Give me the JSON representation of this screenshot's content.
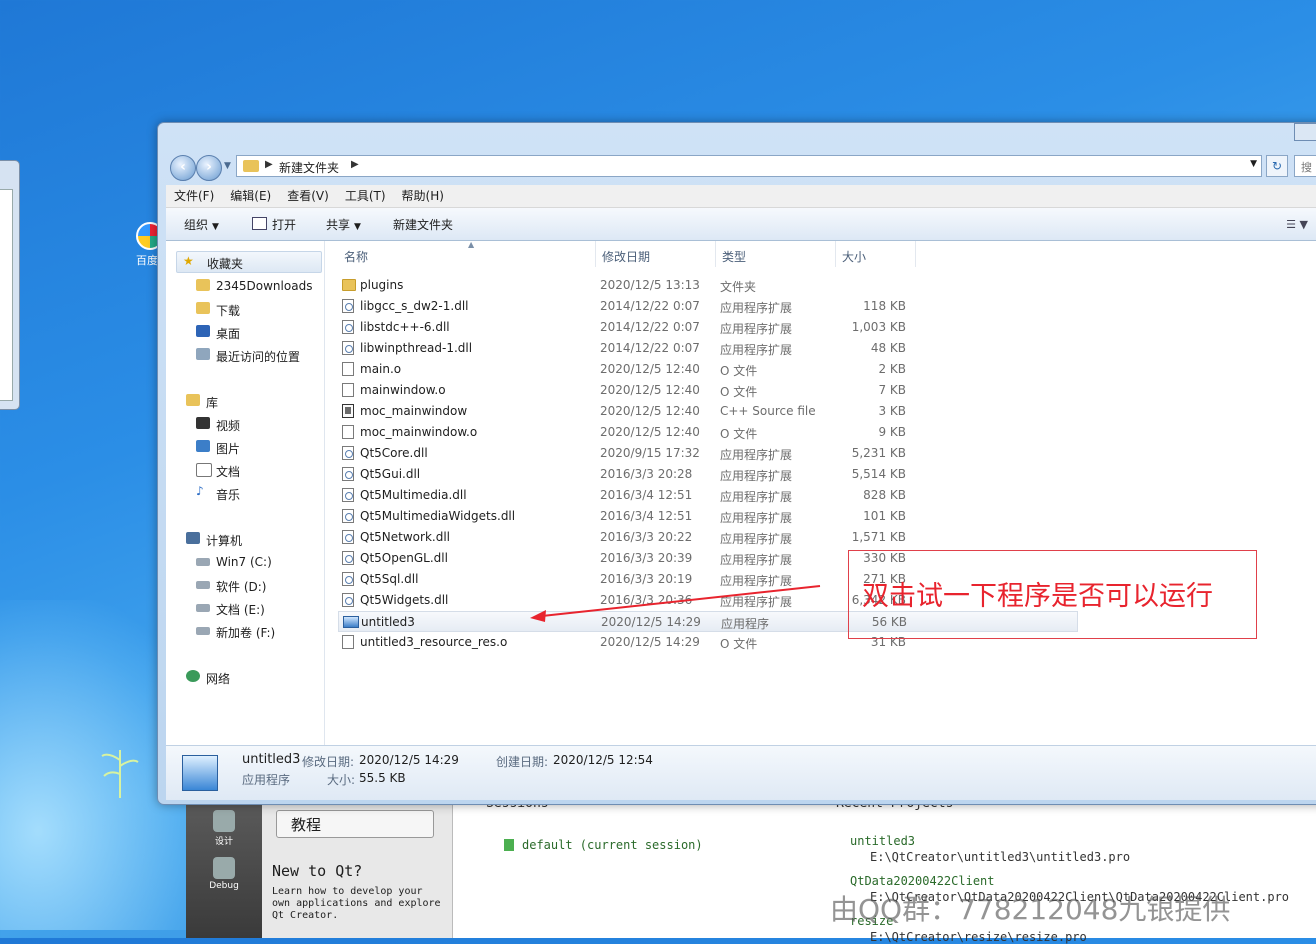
{
  "desktop": {
    "icon_label": "百度",
    "qt": {
      "modes": [
        {
          "label": "设计"
        },
        {
          "label": "Debug"
        }
      ],
      "tutorial_button": "教程",
      "new_heading": "New to Qt?",
      "new_desc": "Learn how to develop your own applications and explore Qt Creator.",
      "sessions_title": "Sessions",
      "session_item": "default (current session)",
      "recent_title": "Recent Projects",
      "recent": [
        {
          "name": "untitled3",
          "path": "E:\\QtCreator\\untitled3\\untitled3.pro"
        },
        {
          "name": "QtData20200422Client",
          "path": "E:\\QtCreator\\QtData20200422Client\\QtData20200422Client.pro"
        },
        {
          "name": "resize",
          "path": "E:\\QtCreator\\resize\\resize.pro"
        }
      ]
    },
    "watermark": "由QQ群：778212048九银提供"
  },
  "explorer": {
    "address": {
      "crumb": "新建文件夹",
      "search_placeholder": "搜"
    },
    "menu": [
      "文件(F)",
      "编辑(E)",
      "查看(V)",
      "工具(T)",
      "帮助(H)"
    ],
    "toolbar": {
      "organize": "组织",
      "open": "打开",
      "share": "共享",
      "new_folder": "新建文件夹"
    },
    "nav": {
      "favorites": "收藏夹",
      "fav_items": [
        "2345Downloads",
        "下载",
        "桌面",
        "最近访问的位置"
      ],
      "library": "库",
      "lib_items": [
        "视频",
        "图片",
        "文档",
        "音乐"
      ],
      "computer": "计算机",
      "drives": [
        "Win7 (C:)",
        "软件 (D:)",
        "文档 (E:)",
        "新加卷 (F:)"
      ],
      "network": "网络"
    },
    "columns": {
      "name": "名称",
      "date": "修改日期",
      "type": "类型",
      "size": "大小"
    },
    "files": [
      {
        "name": "plugins",
        "date": "2020/12/5 13:13",
        "type": "文件夹",
        "size": "",
        "icon": "folder"
      },
      {
        "name": "libgcc_s_dw2-1.dll",
        "date": "2014/12/22 0:07",
        "type": "应用程序扩展",
        "size": "118 KB",
        "icon": "dll"
      },
      {
        "name": "libstdc++-6.dll",
        "date": "2014/12/22 0:07",
        "type": "应用程序扩展",
        "size": "1,003 KB",
        "icon": "dll"
      },
      {
        "name": "libwinpthread-1.dll",
        "date": "2014/12/22 0:07",
        "type": "应用程序扩展",
        "size": "48 KB",
        "icon": "dll"
      },
      {
        "name": "main.o",
        "date": "2020/12/5 12:40",
        "type": "O 文件",
        "size": "2 KB",
        "icon": "file"
      },
      {
        "name": "mainwindow.o",
        "date": "2020/12/5 12:40",
        "type": "O 文件",
        "size": "7 KB",
        "icon": "file"
      },
      {
        "name": "moc_mainwindow",
        "date": "2020/12/5 12:40",
        "type": "C++ Source file",
        "size": "3 KB",
        "icon": "cpp"
      },
      {
        "name": "moc_mainwindow.o",
        "date": "2020/12/5 12:40",
        "type": "O 文件",
        "size": "9 KB",
        "icon": "file"
      },
      {
        "name": "Qt5Core.dll",
        "date": "2020/9/15 17:32",
        "type": "应用程序扩展",
        "size": "5,231 KB",
        "icon": "dll"
      },
      {
        "name": "Qt5Gui.dll",
        "date": "2016/3/3 20:28",
        "type": "应用程序扩展",
        "size": "5,514 KB",
        "icon": "dll"
      },
      {
        "name": "Qt5Multimedia.dll",
        "date": "2016/3/4 12:51",
        "type": "应用程序扩展",
        "size": "828 KB",
        "icon": "dll"
      },
      {
        "name": "Qt5MultimediaWidgets.dll",
        "date": "2016/3/4 12:51",
        "type": "应用程序扩展",
        "size": "101 KB",
        "icon": "dll"
      },
      {
        "name": "Qt5Network.dll",
        "date": "2016/3/3 20:22",
        "type": "应用程序扩展",
        "size": "1,571 KB",
        "icon": "dll"
      },
      {
        "name": "Qt5OpenGL.dll",
        "date": "2016/3/3 20:39",
        "type": "应用程序扩展",
        "size": "330 KB",
        "icon": "dll"
      },
      {
        "name": "Qt5Sql.dll",
        "date": "2016/3/3 20:19",
        "type": "应用程序扩展",
        "size": "271 KB",
        "icon": "dll"
      },
      {
        "name": "Qt5Widgets.dll",
        "date": "2016/3/3 20:36",
        "type": "应用程序扩展",
        "size": "6,342 KB",
        "icon": "dll"
      },
      {
        "name": "untitled3",
        "date": "2020/12/5 14:29",
        "type": "应用程序",
        "size": "56 KB",
        "icon": "app",
        "selected": true
      },
      {
        "name": "untitled3_resource_res.o",
        "date": "2020/12/5 14:29",
        "type": "O 文件",
        "size": "31 KB",
        "icon": "file"
      }
    ],
    "details": {
      "name": "untitled3",
      "modified_label": "修改日期:",
      "modified": "2020/12/5 14:29",
      "created_label": "创建日期:",
      "created": "2020/12/5 12:54",
      "type": "应用程序",
      "size_label": "大小:",
      "size": "55.5 KB"
    }
  },
  "annotation": {
    "text": "双击试一下程序是否可以运行",
    "color": "#e8242e"
  }
}
